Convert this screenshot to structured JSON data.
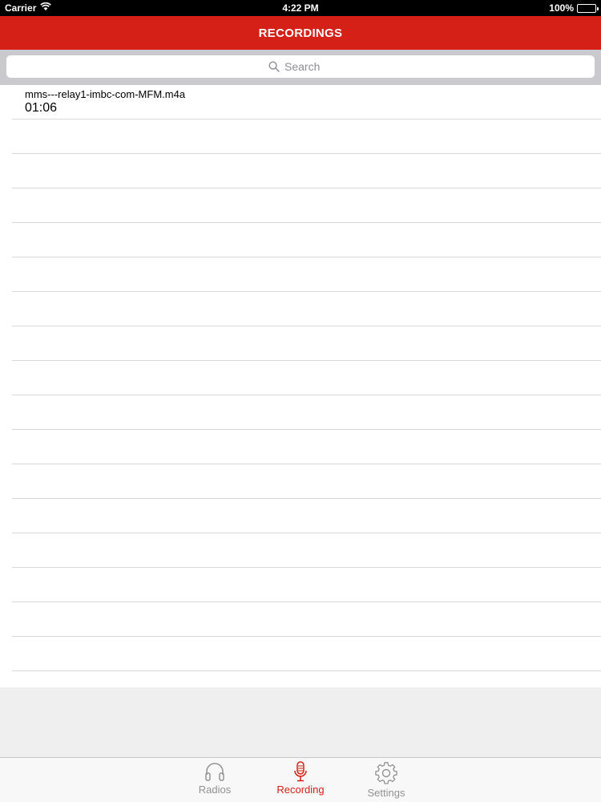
{
  "status_bar": {
    "carrier": "Carrier",
    "time": "4:22 PM",
    "battery": "100%",
    "battery_level": 1.0
  },
  "nav": {
    "title": "RECORDINGS"
  },
  "search": {
    "placeholder": "Search"
  },
  "recordings": [
    {
      "name": "mms---relay1-imbc-com-MFM.m4a",
      "duration": "01:06"
    }
  ],
  "tabs": [
    {
      "label": "Radios",
      "icon": "headphones-icon",
      "active": false
    },
    {
      "label": "Recording",
      "icon": "microphone-icon",
      "active": true
    },
    {
      "label": "Settings",
      "icon": "gear-icon",
      "active": false
    }
  ],
  "colors": {
    "accent": "#d42016",
    "inactive": "#929292"
  }
}
